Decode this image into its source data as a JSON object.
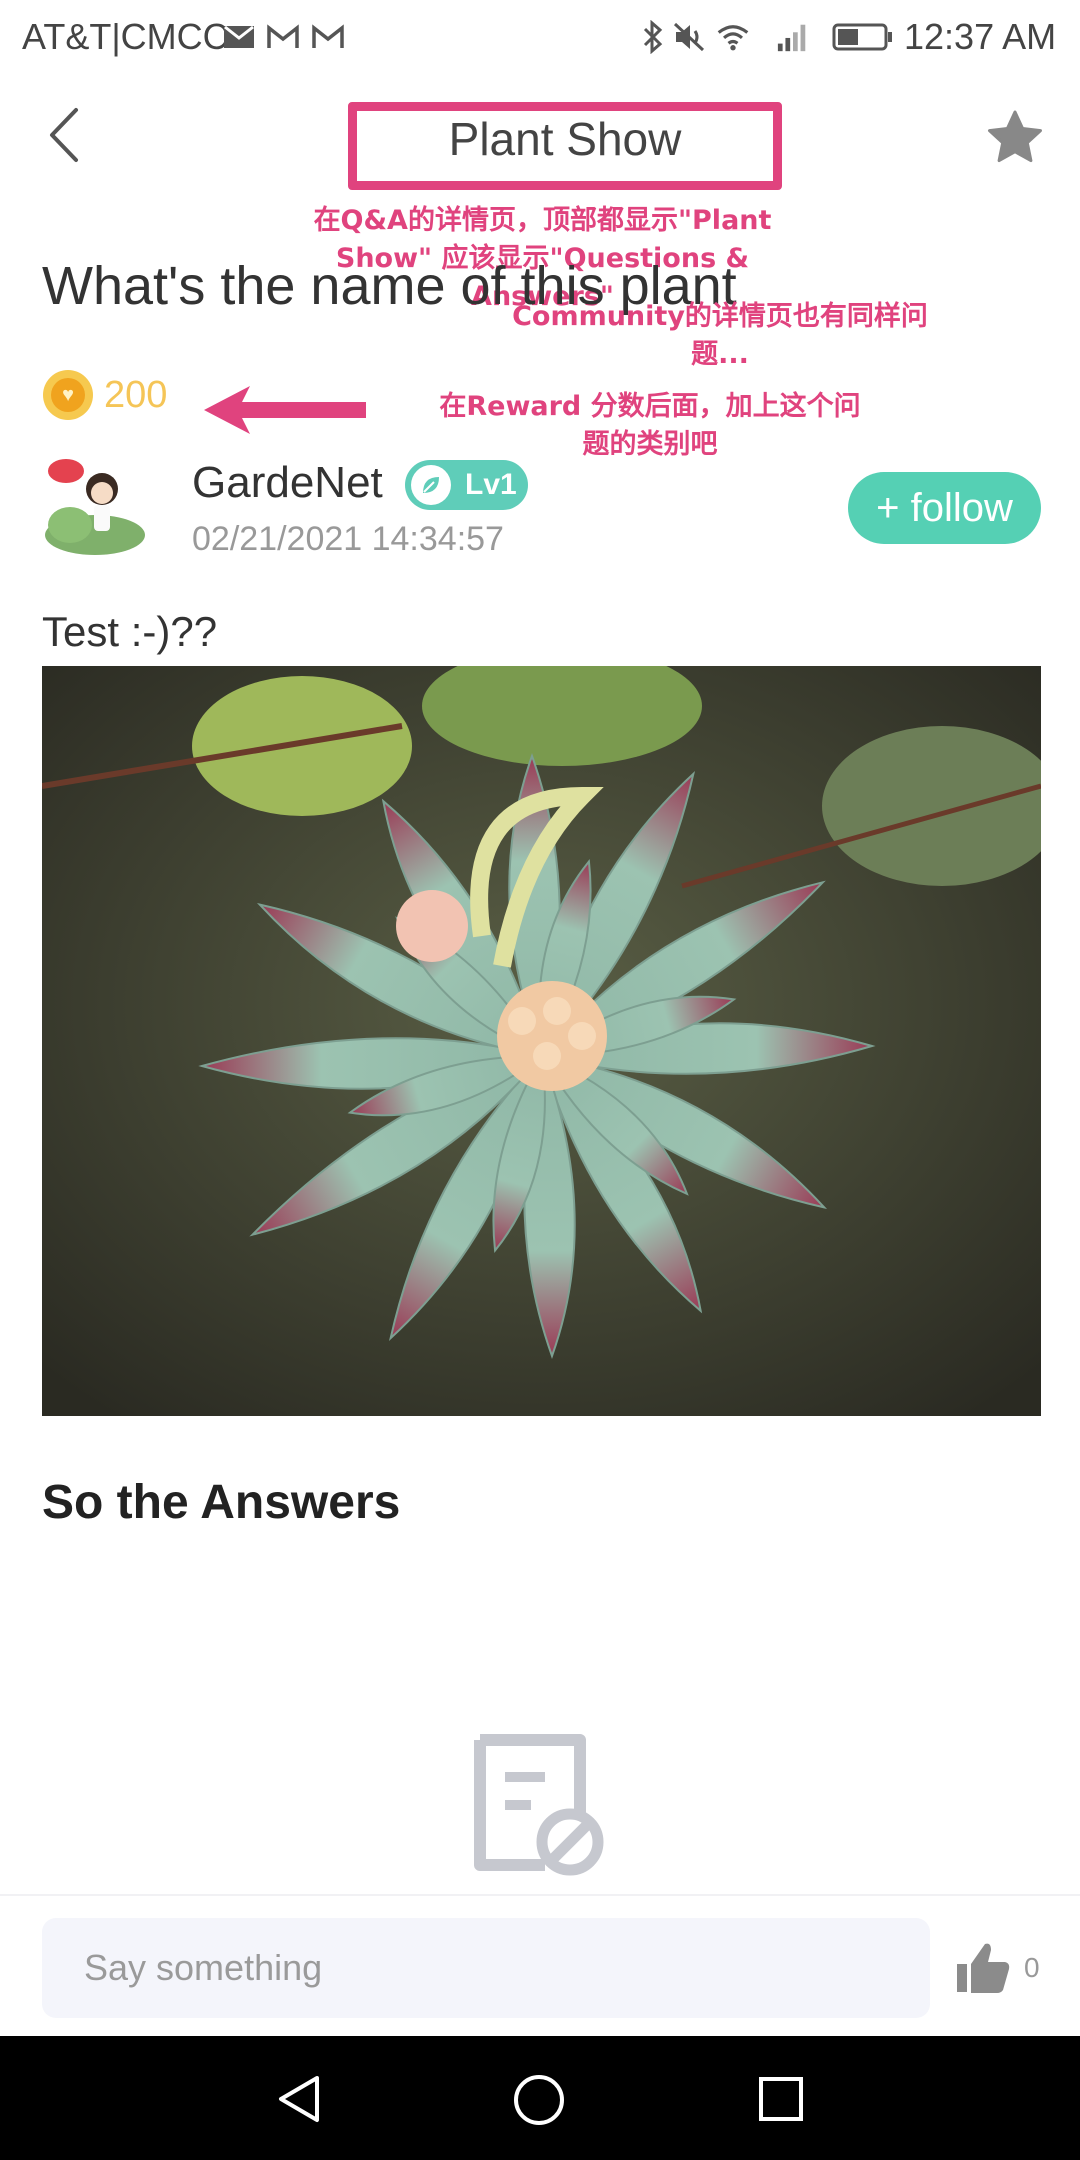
{
  "status_bar": {
    "carrier": "AT&T|CMCC",
    "time": "12:37 AM",
    "icons": [
      "mail-icon",
      "gmail-icon",
      "gmail-icon",
      "bluetooth-icon",
      "mute-icon",
      "wifi-icon",
      "signal-icon",
      "battery-icon"
    ]
  },
  "header": {
    "title": "Plant Show",
    "back_icon": "chevron-left-icon",
    "favorite_icon": "star-icon"
  },
  "annotations": {
    "note1_line1": "在Q&A的详情页，顶部都显示\"Plant",
    "note1_line2": "Show\" 应该显示\"Questions & Answers\"",
    "note2_line1": "Community的详情页也有同样问",
    "note2_line2": "题...",
    "note3_line1": "在Reward 分数后面，加上这个问",
    "note3_line2": "题的类别吧"
  },
  "post": {
    "title": "What's the name of this plant",
    "reward": "200",
    "author": "GardeNet",
    "level": "Lv1",
    "date": "02/21/2021 14:34:57",
    "follow_label": "+ follow",
    "text": "Test :-)??"
  },
  "answers": {
    "heading": "So the Answers"
  },
  "footer": {
    "comment_placeholder": "Say something",
    "like_count": "0"
  },
  "colors": {
    "accent_pink": "#e0437e",
    "follow_green": "#55d0b4",
    "level_teal": "#5fcdb9",
    "reward_gold": "#f5c557"
  }
}
